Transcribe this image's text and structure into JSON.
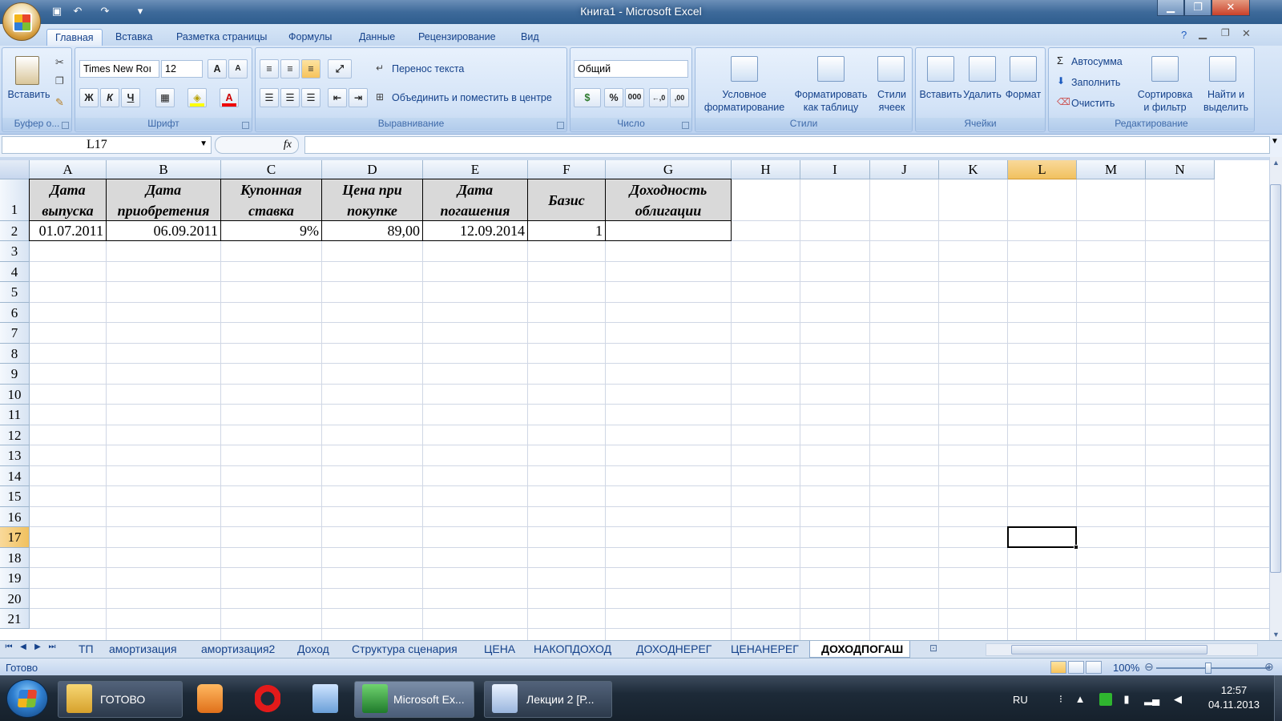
{
  "window": {
    "title": "Книга1 - Microsoft Excel",
    "minimize_icon": "minimize-icon",
    "maximize_icon": "restore-icon",
    "close_icon": "close-icon"
  },
  "quick_access": [
    "save-icon",
    "undo-icon",
    "redo-icon",
    "customize-icon"
  ],
  "ribbon": {
    "tabs": [
      "Главная",
      "Вставка",
      "Разметка страницы",
      "Формулы",
      "Данные",
      "Рецензирование",
      "Вид"
    ],
    "active_tab": "Главная",
    "clipboard": {
      "label": "Буфер о...",
      "paste": "Вставить"
    },
    "font": {
      "label": "Шрифт",
      "name": "Times New Roı",
      "size": "12",
      "bold": "Ж",
      "italic": "К",
      "underline": "Ч",
      "grow": "A",
      "shrink": "A",
      "font_color_glyph": "A"
    },
    "alignment": {
      "label": "Выравнивание",
      "wrap": "Перенос текста",
      "merge": "Объединить и поместить в центре"
    },
    "number": {
      "label": "Число",
      "format": "Общий",
      "percent": "%",
      "thousands": "000",
      "inc_decimal": "←,0",
      "dec_decimal": ",00"
    },
    "styles": {
      "label": "Стили",
      "cond": [
        "Условное",
        "форматирование"
      ],
      "table": [
        "Форматировать",
        "как таблицу"
      ],
      "cell": [
        "Стили",
        "ячеек"
      ]
    },
    "cells": {
      "label": "Ячейки",
      "insert": "Вставить",
      "delete": "Удалить",
      "format": "Формат"
    },
    "editing": {
      "label": "Редактирование",
      "autosum": "Автосумма",
      "fill": "Заполнить",
      "clear": "Очистить",
      "sort": [
        "Сортировка",
        "и фильтр"
      ],
      "find": [
        "Найти и",
        "выделить"
      ]
    }
  },
  "formula_bar": {
    "name_box": "L17",
    "fx": "fx",
    "formula": ""
  },
  "columns": [
    "A",
    "B",
    "C",
    "D",
    "E",
    "F",
    "G",
    "H",
    "I",
    "J",
    "K",
    "L",
    "M",
    "N"
  ],
  "rows": [
    "1",
    "2",
    "3",
    "4",
    "5",
    "6",
    "7",
    "8",
    "9",
    "10",
    "11",
    "12",
    "13",
    "14",
    "15",
    "16",
    "17",
    "18",
    "19",
    "20",
    "21"
  ],
  "selected_cell": "L17",
  "table": {
    "headers": [
      "Дата выпуска",
      "Дата приобретения",
      "Купонная ставка",
      "Цена при покупке",
      "Дата погашения",
      "Базис",
      "Доходность облигации"
    ],
    "row2": [
      "01.07.2011",
      "06.09.2011",
      "9%",
      "89,00",
      "12.09.2014",
      "1",
      ""
    ]
  },
  "sheet_tabs": [
    "ТП",
    "амортизация",
    "амортизация2",
    "Доход",
    "Структура сценария",
    "ЦЕНА",
    "НАКОПДОХОД",
    "ДОХОДНЕРЕГ",
    "ЦЕНАНЕРЕГ",
    "ДОХОДПОГАШ"
  ],
  "active_sheet": "ДОХОДПОГАШ",
  "status": {
    "text": "Готово",
    "zoom": "100%"
  },
  "taskbar": {
    "items": [
      "ГОТОВО",
      "Microsoft Ex...",
      "Лекции 2 [Р..."
    ],
    "lang": "RU",
    "time": "12:57",
    "date": "04.11.2013"
  },
  "colors": {
    "accent": "#15428b",
    "selected_header": "#f1c15f",
    "header_fill": "#d9d9d9"
  }
}
